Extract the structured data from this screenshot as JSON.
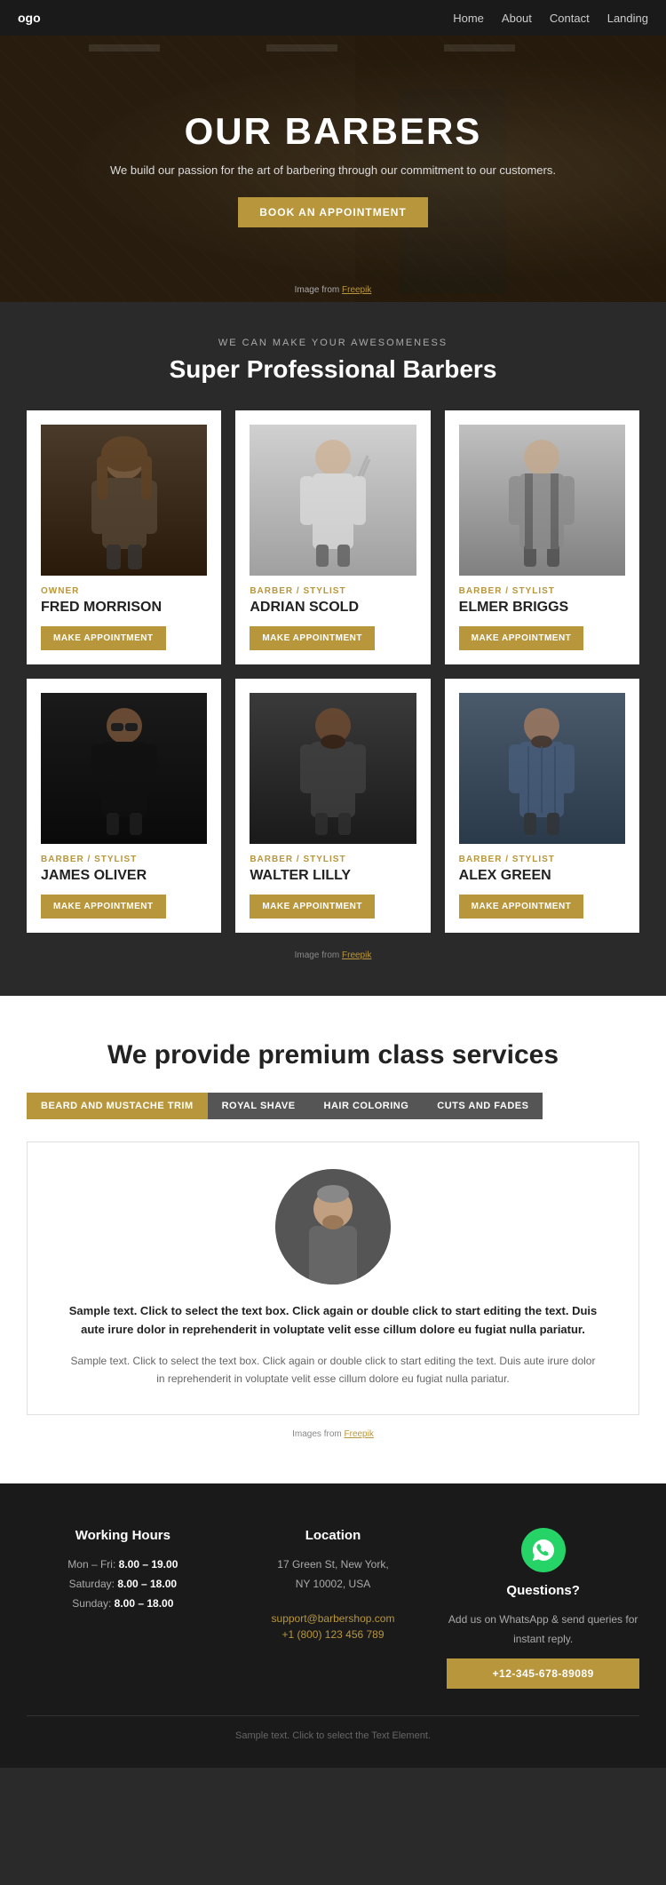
{
  "nav": {
    "logo": "ogo",
    "links": [
      "Home",
      "About",
      "Contact",
      "Landing"
    ]
  },
  "hero": {
    "title": "OUR BARBERS",
    "subtitle": "We build our passion for the art of barbering through our commitment to our customers.",
    "cta_label": "BOOK AN APPOINTMENT",
    "credit_text": "Image from ",
    "credit_link": "Freepik"
  },
  "barbers_section": {
    "subtitle": "WE CAN MAKE YOUR AWESOMENESS",
    "title": "Super Professional Barbers",
    "barbers": [
      {
        "role": "OWNER",
        "name": "FRED MORRISON",
        "btn": "MAKE APPOINTMENT",
        "img_class": "barber-img-1"
      },
      {
        "role": "BARBER / STYLIST",
        "name": "ADRIAN SCOLD",
        "btn": "MAKE APPOINTMENT",
        "img_class": "barber-img-2"
      },
      {
        "role": "BARBER / STYLIST",
        "name": "ELMER BRIGGS",
        "btn": "MAKE APPOINTMENT",
        "img_class": "barber-img-3"
      },
      {
        "role": "BARBER / STYLIST",
        "name": "JAMES OLIVER",
        "btn": "MAKE APPOINTMENT",
        "img_class": "barber-img-4"
      },
      {
        "role": "BARBER / STYLIST",
        "name": "WALTER LILLY",
        "btn": "MAKE APPOINTMENT",
        "img_class": "barber-img-5"
      },
      {
        "role": "BARBER / STYLIST",
        "name": "ALEX GREEN",
        "btn": "MAKE APPOINTMENT",
        "img_class": "barber-img-6"
      }
    ],
    "credit_text": "Image from ",
    "credit_link": "Freepik"
  },
  "services_section": {
    "title": "We provide premium class services",
    "tabs": [
      {
        "label": "BEARD AND MUSTACHE TRIM",
        "active": true
      },
      {
        "label": "ROYAL SHAVE",
        "active": false
      },
      {
        "label": "HAIR COLORING",
        "active": false
      },
      {
        "label": "CUTS AND FADES",
        "active": false
      }
    ],
    "service_desc_bold": "Sample text. Click to select the text box. Click again or double click to start editing the text. Duis aute irure dolor in reprehenderit in voluptate velit esse cillum dolore eu fugiat nulla pariatur.",
    "service_desc": "Sample text. Click to select the text box. Click again or double click to start editing the text. Duis aute irure dolor in reprehenderit in voluptate velit esse cillum dolore eu fugiat nulla pariatur.",
    "credit_text": "Images from ",
    "credit_link": "Freepik"
  },
  "footer": {
    "working_hours": {
      "title": "Working Hours",
      "lines": [
        {
          "label": "Mon – Fri:",
          "value": "8.00 – 19.00"
        },
        {
          "label": "Saturday:",
          "value": "8.00 – 18.00"
        },
        {
          "label": "Sunday:",
          "value": "8.00 – 18.00"
        }
      ]
    },
    "location": {
      "title": "Location",
      "address_line1": "17 Green St, New York,",
      "address_line2": "NY 10002, USA",
      "email": "support@barbershop.com",
      "phone": "+1 (800) 123 456 789"
    },
    "questions": {
      "title": "Questions?",
      "desc": "Add us on WhatsApp & send queries for instant reply.",
      "btn_label": "+12-345-678-89089"
    },
    "bottom_text": "Sample text. Click to select the Text Element."
  },
  "colors": {
    "accent": "#b8963c",
    "dark_bg": "#2a2a2a",
    "darker_bg": "#1a1a1a",
    "white": "#ffffff"
  }
}
